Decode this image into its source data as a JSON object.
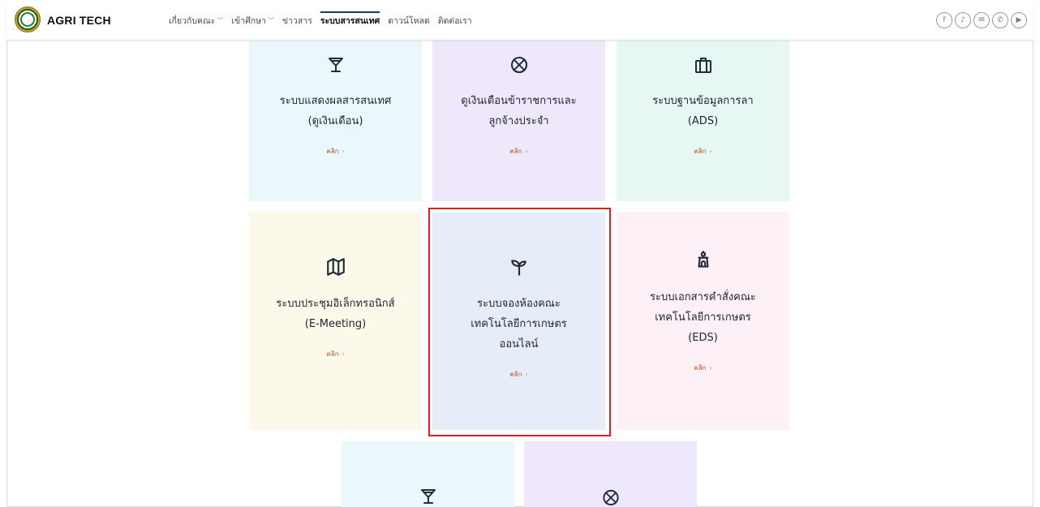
{
  "header": {
    "brand": "AGRI TECH",
    "nav": [
      {
        "label": "เกี่ยวกับคณะ",
        "has_dropdown": true,
        "active": false
      },
      {
        "label": "เข้าศึกษา",
        "has_dropdown": true,
        "active": false
      },
      {
        "label": "ข่าวสาร",
        "has_dropdown": false,
        "active": false
      },
      {
        "label": "ระบบสารสนเทศ",
        "has_dropdown": false,
        "active": true
      },
      {
        "label": "ดาวน์โหลด",
        "has_dropdown": false,
        "active": false
      },
      {
        "label": "ติดต่อเรา",
        "has_dropdown": false,
        "active": false
      }
    ],
    "social": [
      "facebook-icon",
      "tiktok-icon",
      "mail-icon",
      "phone-icon",
      "youtube-icon"
    ]
  },
  "cards": [
    {
      "icon": "cocktail-glass-icon",
      "title_lines": [
        "ระบบแสดงผลสารสนเทศ",
        "(ดูเงินเดือน)"
      ],
      "link": "คลิก"
    },
    {
      "icon": "basketball-icon",
      "title_lines": [
        "ดูเงินเดือนข้าราชการและ",
        "ลูกจ้างประจำ"
      ],
      "link": "คลิก"
    },
    {
      "icon": "briefcase-icon",
      "title_lines": [
        "ระบบฐานข้อมูลการลา",
        "(ADS)"
      ],
      "link": "คลิก"
    },
    {
      "icon": "map-icon",
      "title_lines": [
        "ระบบประชุมอิเล็กทรอนิกส์",
        "(E-Meeting)"
      ],
      "link": "คลิก"
    },
    {
      "icon": "sprout-icon",
      "title_lines": [
        "ระบบจองห้องคณะ",
        "เทคโนโลยีการเกษตร",
        "ออนไลน์"
      ],
      "link": "คลิก"
    },
    {
      "icon": "scooter-icon",
      "title_lines": [
        "ระบบเอกสารคำสั่งคณะ",
        "เทคโนโลยีการเกษตร",
        "(EDS)"
      ],
      "link": "คลิก"
    },
    {
      "icon": "cocktail-glass-icon",
      "title_lines": [],
      "link": ""
    },
    {
      "icon": "basketball-icon",
      "title_lines": [],
      "link": ""
    }
  ],
  "colors": {
    "highlight": "#e02020",
    "link": "#c0502a"
  }
}
